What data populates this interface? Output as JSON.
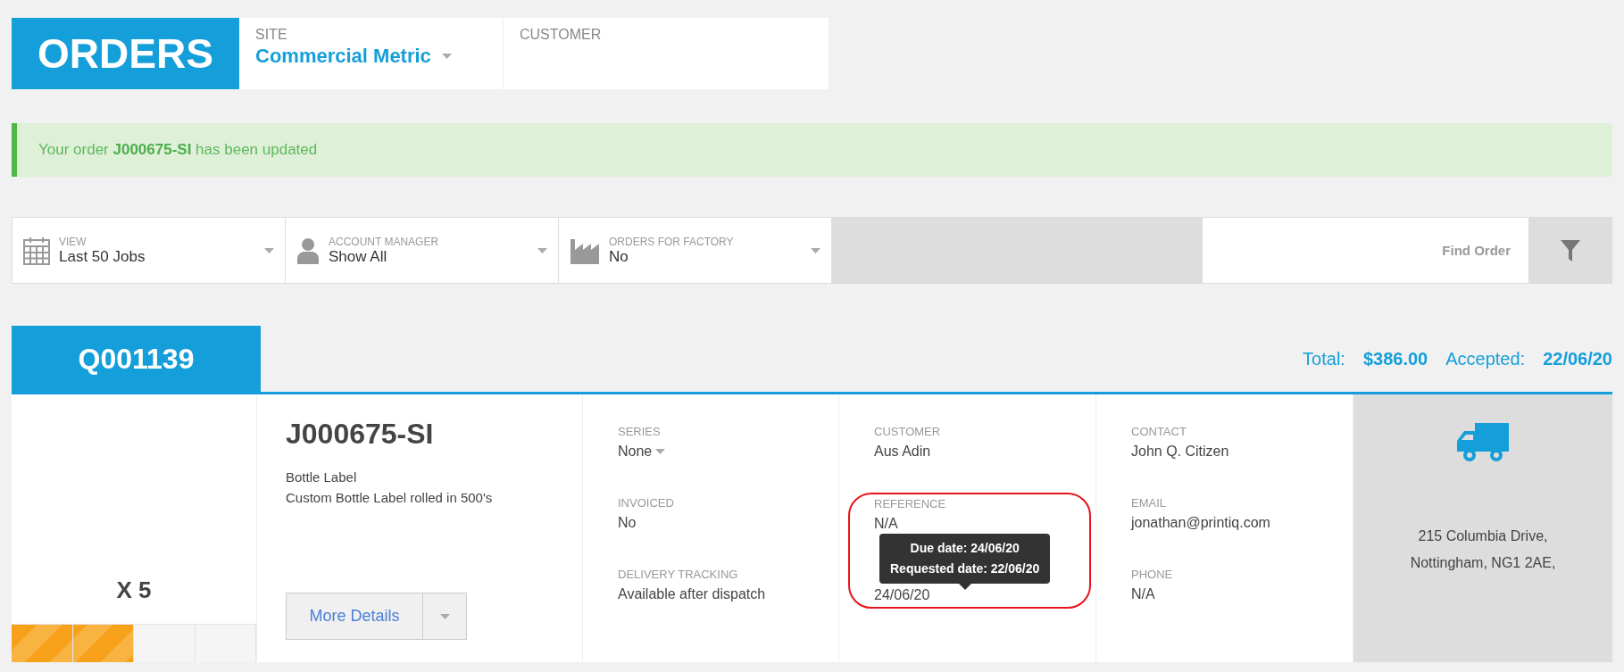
{
  "header": {
    "title": "ORDERS",
    "site": {
      "label": "SITE",
      "value": "Commercial Metric"
    },
    "customer": {
      "label": "CUSTOMER"
    }
  },
  "alert": {
    "text": "Your order **J000675-SI** has been updated"
  },
  "filters": [
    {
      "kind": "calendar",
      "label": "VIEW",
      "value": "Last 50 Jobs"
    },
    {
      "kind": "person",
      "label": "ACCOUNT MANAGER",
      "value": "Show All"
    },
    {
      "kind": "factory",
      "label": "ORDERS FOR FACTORY",
      "value": "No"
    }
  ],
  "search": {
    "placeholder": "Find Order"
  },
  "order": {
    "number": "Q001139",
    "total_label": "Total:",
    "total": "$386.00",
    "accepted_label": "Accepted:",
    "accepted": "22/06/20",
    "quantity": "X 5",
    "progress": {
      "level": 0.5
    },
    "job": {
      "number": "J000675-SI",
      "title": "Bottle Label",
      "description": "Custom Bottle Label rolled in 500's",
      "button": "More Details"
    },
    "columns": [
      [
        {
          "kind": "dropdown",
          "label": "SERIES",
          "value": "None"
        },
        {
          "kind": "text",
          "label": "INVOICED",
          "value": "No"
        },
        {
          "kind": "text",
          "label": "DELIVERY TRACKING",
          "value": "Available after dispatch"
        }
      ],
      [
        {
          "kind": "text",
          "label": "CUSTOMER",
          "value": "Aus Adin"
        },
        {
          "kind": "text",
          "label": "REFERENCE",
          "value": "N/A"
        },
        {
          "kind": "text",
          "value": "24/06/20"
        }
      ],
      [
        {
          "kind": "text",
          "label": "CONTACT",
          "value": "John Q. Citizen"
        },
        {
          "kind": "text",
          "label": "EMAIL",
          "value": "jonathan@printiq.com"
        },
        {
          "kind": "text",
          "label": "PHONE",
          "value": "N/A"
        }
      ]
    ],
    "tooltip": {
      "lines": [
        "Due date: 24/06/20",
        "Requested date: 22/06/20"
      ]
    },
    "address": [
      "215 Columbia Drive,",
      "Nottingham, NG1 2AE,"
    ]
  }
}
